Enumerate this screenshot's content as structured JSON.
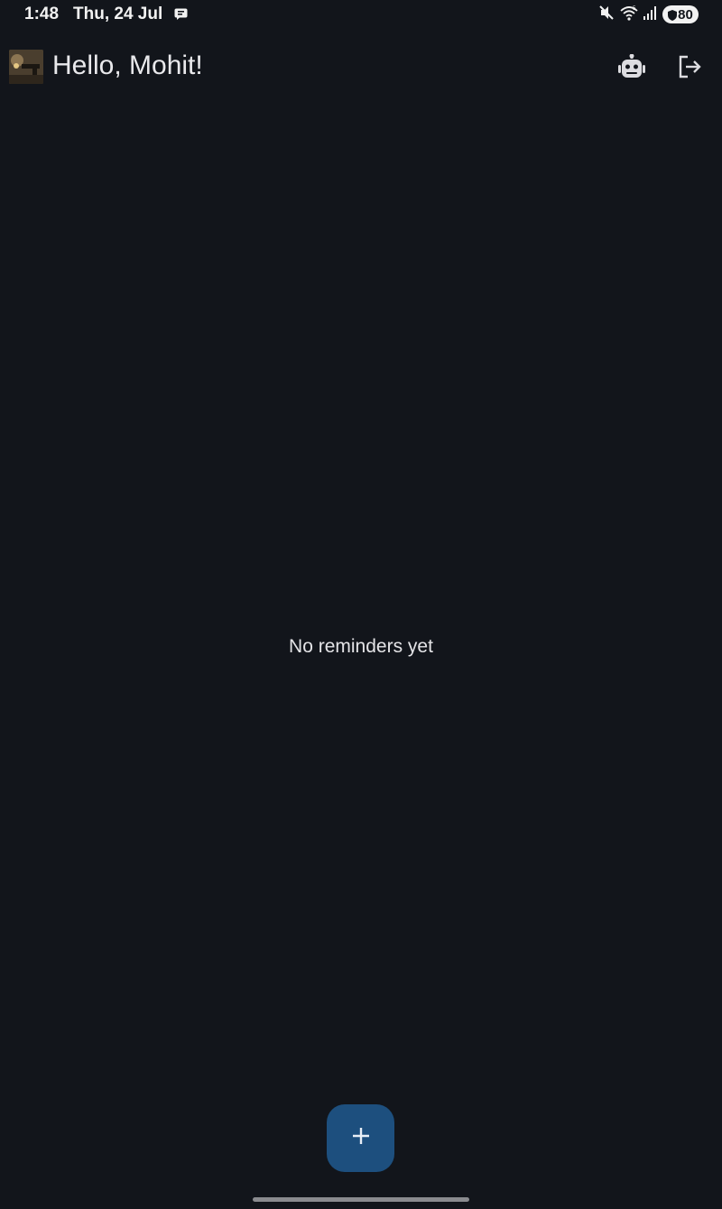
{
  "status_bar": {
    "time": "1:48",
    "date": "Thu, 24 Jul",
    "battery": "80",
    "icons": [
      "notification-message-icon",
      "mute-icon",
      "wifi-icon",
      "signal-icon",
      "battery-icon"
    ]
  },
  "header": {
    "greeting": "Hello, Mohit!",
    "actions": [
      "assistant-bot-icon",
      "logout-icon"
    ]
  },
  "main": {
    "empty_message": "No reminders yet"
  },
  "fab": {
    "icon": "plus-icon"
  },
  "colors": {
    "background": "#12151b",
    "fab": "#1d4f7e",
    "text": "#e6e6e8"
  }
}
